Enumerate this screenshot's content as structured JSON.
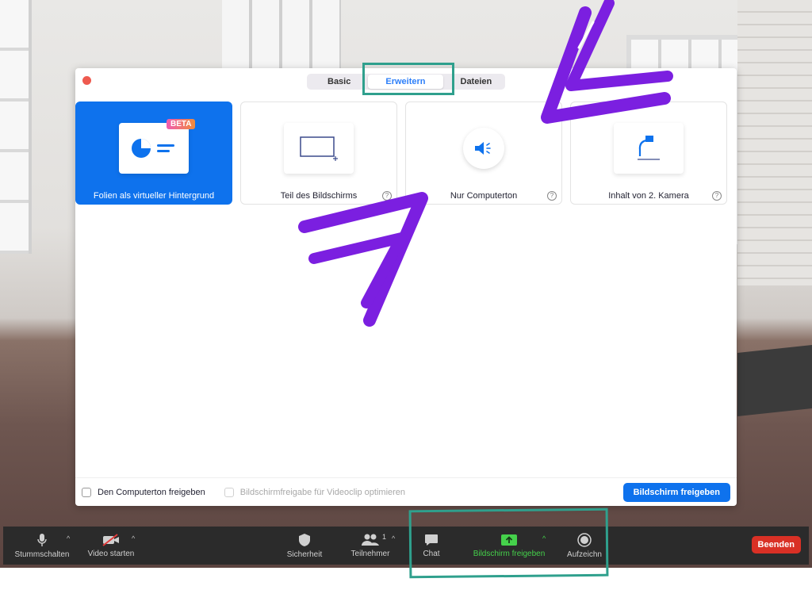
{
  "dialog": {
    "tabs": [
      {
        "label": "Basic",
        "active": false
      },
      {
        "label": "Erweitern",
        "active": true
      },
      {
        "label": "Dateien",
        "active": false
      }
    ],
    "options": [
      {
        "label": "Folien als virtueller Hintergrund",
        "badge": "BETA",
        "selected": true,
        "icon": "slides-icon"
      },
      {
        "label": "Teil des Bildschirms",
        "selected": false,
        "icon": "screen-portion-icon",
        "help": "?"
      },
      {
        "label": "Nur Computerton",
        "selected": false,
        "icon": "speaker-icon",
        "help": "?"
      },
      {
        "label": "Inhalt von 2. Kamera",
        "selected": false,
        "icon": "document-camera-icon",
        "help": "?"
      }
    ],
    "footer": {
      "computer_audio": "Den Computerton freigeben",
      "optimize_video": "Bildschirmfreigabe für Videoclip optimieren",
      "share_button": "Bildschirm freigeben"
    }
  },
  "toolbar": {
    "mute": "Stummschalten",
    "video": "Video starten",
    "security": "Sicherheit",
    "participants": "Teilnehmer",
    "participants_count": "1",
    "chat": "Chat",
    "share": "Bildschirm freigeben",
    "record": "Aufzeichn",
    "end": "Beenden"
  },
  "colors": {
    "accent": "#0e72ed",
    "share_green": "#45d14b",
    "end_red": "#d93025",
    "annotation_teal": "#2fa08d",
    "annotation_purple": "#7b1fe0"
  }
}
